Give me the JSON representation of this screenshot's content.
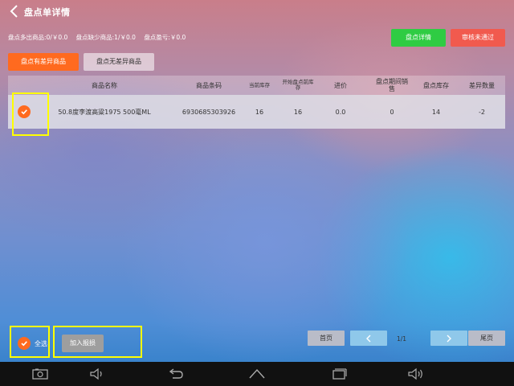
{
  "header": {
    "title": "盘点单详情"
  },
  "summary": {
    "over": "盘点多出商品:0/￥0.0",
    "short": "盘点缺少商品:1/￥0.0",
    "profit": "盘点盈亏:￥0.0"
  },
  "actions": {
    "detail_label": "盘点详情",
    "reject_label": "审核未通过"
  },
  "tabs": [
    {
      "label": "盘点有差异商品",
      "active": true
    },
    {
      "label": "盘点无差异商品",
      "active": false
    }
  ],
  "table": {
    "columns": {
      "name": "商品名称",
      "barcode": "商品条码",
      "current_stock": "当前库存",
      "start_stock_line1": "开始盘点前库",
      "start_stock_line2": "存",
      "purchase_price": "进价",
      "period_sales_line1": "盘点期间销",
      "period_sales_line2": "售",
      "counted_stock": "盘点库存",
      "difference": "差异数量"
    },
    "rows": [
      {
        "checked": true,
        "name": "50.8度李渡高粱1975 500毫ML",
        "barcode": "6930685303926",
        "current_stock": "16",
        "start_stock": "16",
        "purchase_price": "0.0",
        "period_sales": "0",
        "counted_stock": "14",
        "difference": "-2"
      }
    ]
  },
  "footer": {
    "select_all_label": "全选",
    "select_all_checked": true,
    "report_loss_label": "加入报损",
    "pager": {
      "first_label": "首页",
      "prev_label": "<",
      "page_info": "1/1",
      "next_label": ">",
      "last_label": "尾页"
    }
  },
  "colors": {
    "accent_orange": "#ff6a1f",
    "green_button": "#2fcc43",
    "red_button": "#f15a4e",
    "highlight": "#ffff00"
  },
  "navbar": {
    "icons": [
      "screenshot-icon",
      "volume-down-icon",
      "back-icon",
      "home-icon",
      "recents-icon",
      "volume-up-icon"
    ]
  }
}
